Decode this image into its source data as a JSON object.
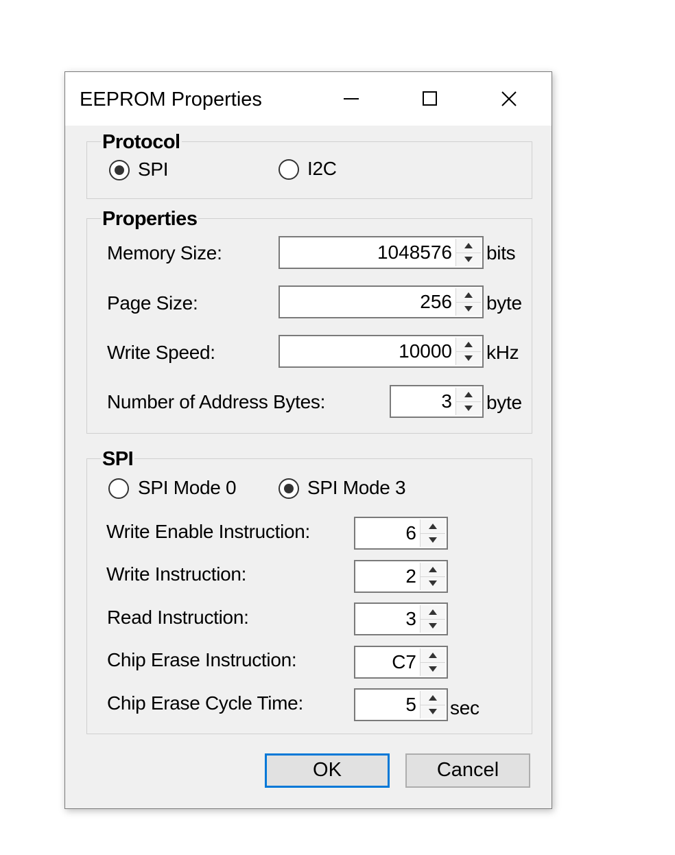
{
  "window": {
    "title": "EEPROM Properties"
  },
  "protocol": {
    "group_label": "Protocol",
    "options": [
      {
        "label": "SPI",
        "selected": true
      },
      {
        "label": "I2C",
        "selected": false
      }
    ]
  },
  "properties": {
    "group_label": "Properties",
    "memory_size": {
      "label": "Memory Size:",
      "value": "1048576",
      "unit": "bits"
    },
    "page_size": {
      "label": "Page Size:",
      "value": "256",
      "unit": "byte"
    },
    "write_speed": {
      "label": "Write Speed:",
      "value": "10000",
      "unit": "kHz"
    },
    "address_bytes": {
      "label": "Number of Address Bytes:",
      "value": "3",
      "unit": "byte"
    }
  },
  "spi": {
    "group_label": "SPI",
    "modes": [
      {
        "label": "SPI Mode 0",
        "selected": false
      },
      {
        "label": "SPI Mode 3",
        "selected": true
      }
    ],
    "write_enable": {
      "label": "Write Enable Instruction:",
      "value": "6"
    },
    "write": {
      "label": "Write Instruction:",
      "value": "2"
    },
    "read": {
      "label": "Read Instruction:",
      "value": "3"
    },
    "chip_erase": {
      "label": "Chip Erase Instruction:",
      "value": "C7"
    },
    "chip_erase_time": {
      "label": "Chip Erase Cycle Time:",
      "value": "5",
      "unit": "sec"
    }
  },
  "buttons": {
    "ok": "OK",
    "cancel": "Cancel"
  },
  "colors": {
    "default_button_border": "#0078d7",
    "dialog_bg": "#f0f0f0"
  }
}
